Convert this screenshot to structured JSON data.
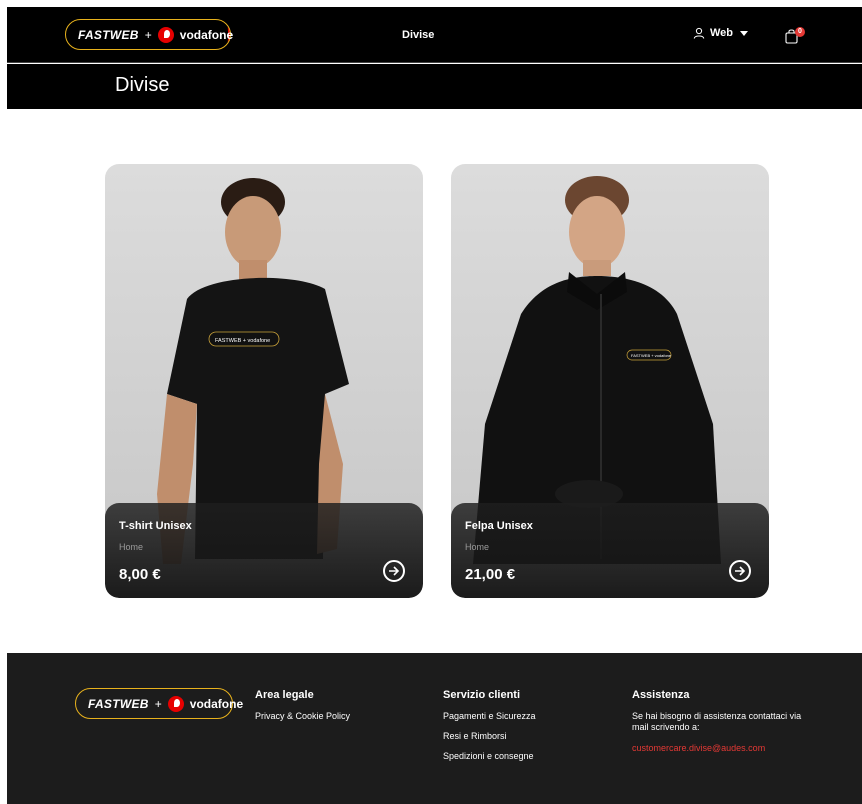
{
  "header": {
    "logo": {
      "brand_a": "FASTWEB",
      "plus": "+",
      "brand_b": "vodafone"
    },
    "nav_center": "Divise",
    "user_label": "Web",
    "cart_count": "0"
  },
  "page": {
    "title": "Divise"
  },
  "products": [
    {
      "name": "T-shirt Unisex",
      "category": "Home",
      "price": "8,00 €",
      "logo_text": "FASTWEB + vodafone"
    },
    {
      "name": "Felpa Unisex",
      "category": "Home",
      "price": "21,00 €",
      "logo_text": "FASTWEB + vodafone"
    }
  ],
  "footer": {
    "logo": {
      "brand_a": "FASTWEB",
      "plus": "+",
      "brand_b": "vodafone"
    },
    "legal": {
      "heading": "Area legale",
      "links": [
        "Privacy & Cookie Policy"
      ]
    },
    "service": {
      "heading": "Servizio clienti",
      "links": [
        "Pagamenti e Sicurezza",
        "Resi e Rimborsi",
        "Spedizioni e consegne"
      ]
    },
    "support": {
      "heading": "Assistenza",
      "text": "Se hai bisogno di assistenza contattaci via mail scrivendo a:",
      "email": "customercare.divise@audes.com"
    }
  },
  "colors": {
    "accent_red": "#e60000",
    "brand_yellow": "#e8b21c",
    "footer_bg": "#1c1c1c",
    "link_red": "#e53935"
  }
}
